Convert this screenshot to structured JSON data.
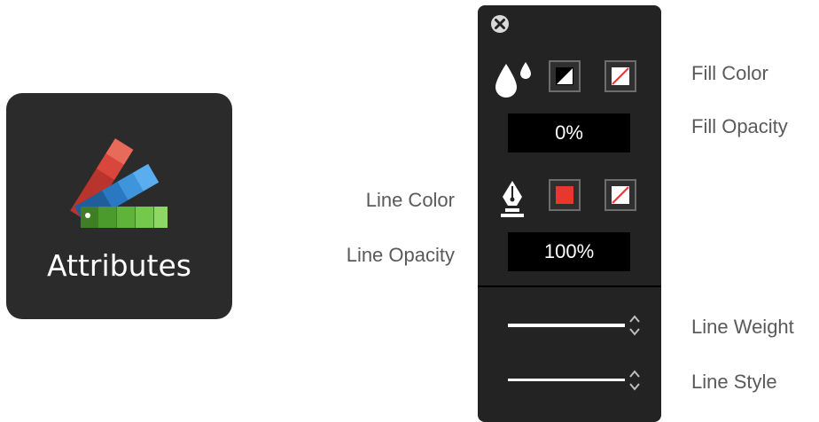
{
  "app_icon": {
    "label": "Attributes",
    "icon": "color-swatch-fan-icon",
    "background": "#2b2b2b"
  },
  "panel": {
    "close_icon": "close-circle-icon",
    "fill": {
      "icon": "droplets-icon",
      "color_swatch_icon": "black-white-swatch-icon",
      "none_swatch_icon": "no-color-swatch-icon",
      "opacity": "0%"
    },
    "line": {
      "icon": "pen-nib-icon",
      "color_swatch": "#e8372d",
      "none_swatch_icon": "no-color-swatch-icon",
      "opacity": "100%"
    },
    "weight_stepper_icon": "up-down-chevron-icon",
    "style_stepper_icon": "up-down-chevron-icon"
  },
  "callouts": {
    "fill_color": "Fill Color",
    "fill_opacity": "Fill Opacity",
    "line_color": "Line Color",
    "line_opacity": "Line Opacity",
    "line_weight": "Line Weight",
    "line_style": "Line Style"
  }
}
